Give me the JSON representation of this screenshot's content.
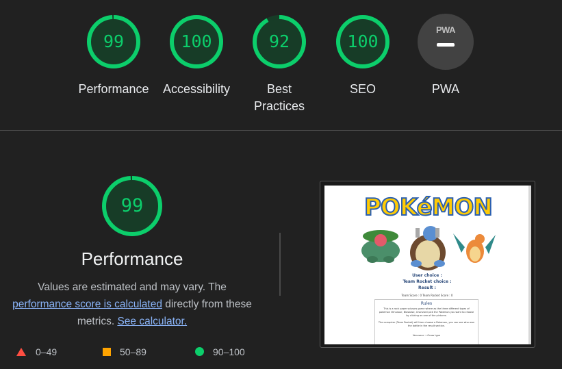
{
  "gauges": [
    {
      "label": "Performance",
      "score": "99",
      "fraction": 0.99
    },
    {
      "label": "Accessibility",
      "score": "100",
      "fraction": 1.0
    },
    {
      "label": "Best Practices",
      "score": "92",
      "fraction": 0.92
    },
    {
      "label": "SEO",
      "score": "100",
      "fraction": 1.0
    },
    {
      "label": "PWA",
      "badge": "PWA"
    }
  ],
  "performance": {
    "score": "99",
    "fraction": 0.99,
    "title": "Performance",
    "desc_prefix": "Values are estimated and may vary. The ",
    "desc_link1": "performance score is calculated",
    "desc_middle": " directly from these metrics. ",
    "desc_link2": "See calculator."
  },
  "legend": [
    {
      "icon": "triangle-icon",
      "label": "0–49",
      "color": "#ff4e42"
    },
    {
      "icon": "square-icon",
      "label": "50–89",
      "color": "#ffa400"
    },
    {
      "icon": "circle-icon",
      "label": "90–100",
      "color": "#0cce6b"
    }
  ],
  "screenshot": {
    "logo": "POKéMON",
    "user_choice": "User choice :",
    "team_rocket_choice": "Team Rocket choice :",
    "result": "Result :",
    "scores": "Team Score : 0        Team Rocket Score : 0",
    "rules_title": "Rules",
    "rules_text": "This is a rock paper scissors game where as the three different types of pokemon Venusaur, Blastoise, Charizard pick the Pokemon you want to choose by clicking on one of the pictures.",
    "rules_text2": "The computer (Team Rocket) will then choose a Pokemon, you can see who won the battle in the result section.",
    "rules_line3": "Venusaur → Grass type"
  },
  "colors": {
    "pass": "#0cce6b",
    "pass_track": "#173c27",
    "average": "#ffa400",
    "fail": "#ff4e42",
    "background": "#212121",
    "link": "#8ab4f8"
  }
}
